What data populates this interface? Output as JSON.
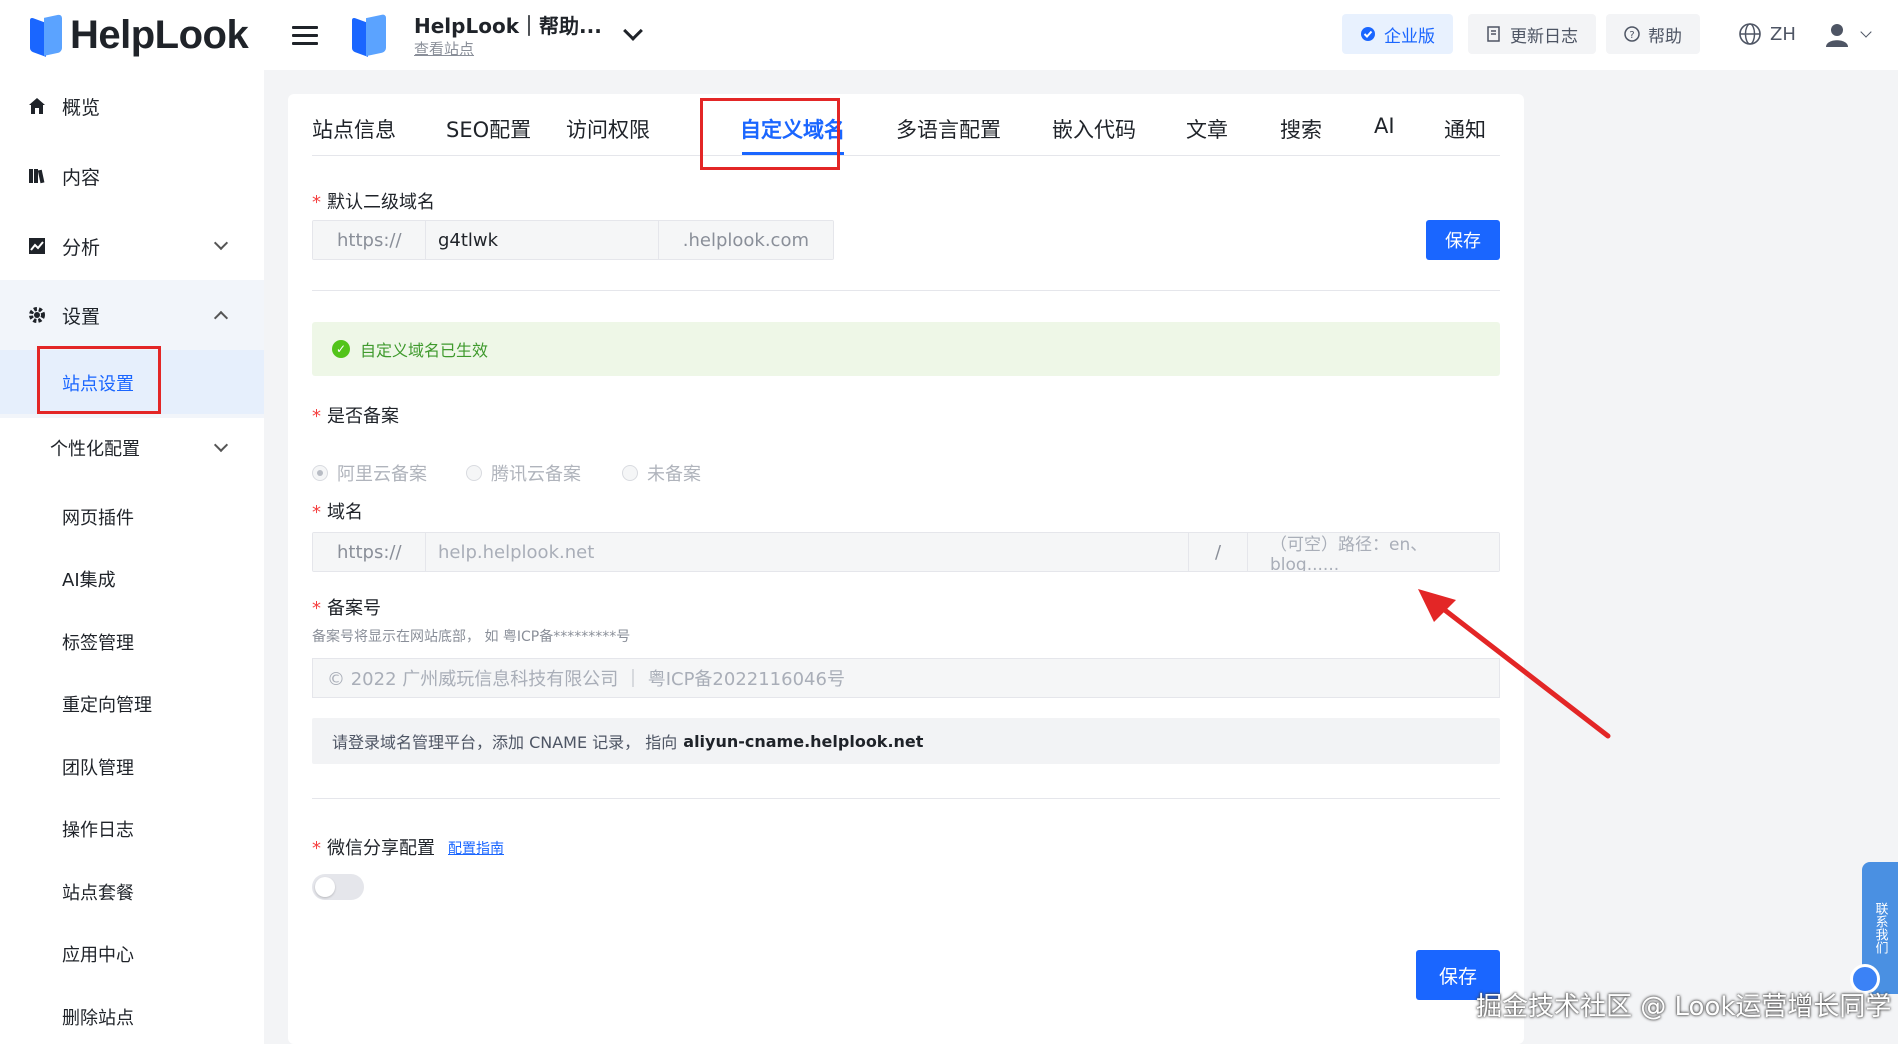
{
  "brand": {
    "logo_text": "HelpLook"
  },
  "sidebar": {
    "items": [
      {
        "label": "概览",
        "icon": "home-icon"
      },
      {
        "label": "内容",
        "icon": "book-icon"
      },
      {
        "label": "分析",
        "icon": "chart-icon"
      },
      {
        "label": "设置",
        "icon": "gear-icon"
      }
    ],
    "settings_sub": {
      "active": "站点设置",
      "personal": "个性化配置"
    },
    "personal_items": [
      "网页插件",
      "AI集成",
      "标签管理",
      "重定向管理",
      "团队管理",
      "操作日志",
      "站点套餐",
      "应用中心",
      "删除站点"
    ]
  },
  "topbar": {
    "site_name": "HelpLook｜帮助...",
    "view_site": "查看站点",
    "enterprise": "企业版",
    "changelog": "更新日志",
    "help": "帮助",
    "language": "ZH"
  },
  "tabs": [
    "站点信息",
    "SEO配置",
    "访问权限",
    "自定义域名",
    "多语言配置",
    "嵌入代码",
    "文章",
    "搜索",
    "AI",
    "通知"
  ],
  "active_tab": "自定义域名",
  "form": {
    "subdomain_label": "默认二级域名",
    "subdomain_prefix": "https://",
    "subdomain_value": "g4tlwk",
    "subdomain_suffix": ".helplook.com",
    "save_label": "保存",
    "alert_text": "自定义域名已生效",
    "filing_label": "是否备案",
    "filing_options": [
      "阿里云备案",
      "腾讯云备案",
      "未备案"
    ],
    "domain_label": "域名",
    "domain_prefix": "https://",
    "domain_value": "help.helplook.net",
    "path_sep": "/",
    "path_placeholder": "（可空）路径：en、blog......",
    "icp_label": "备案号",
    "icp_hint": "备案号将显示在网站底部， 如 粤ICP备*********号",
    "icp_value": "© 2022 广州威玩信息科技有限公司  ｜  粤ICP备2022116046号",
    "cname_text": "请登录域名管理平台，添加 CNAME 记录， 指向",
    "cname_target": "aliyun-cname.helplook.net",
    "wechat_label": "微信分享配置",
    "wechat_guide": "配置指南",
    "bottom_save": "保存"
  },
  "float_panel": "联系我们",
  "watermark": "掘金技术社区 @ Look运营增长同学",
  "colors": {
    "accent": "#1a66ff",
    "highlight": "#e32626",
    "success": "#52c41a"
  }
}
